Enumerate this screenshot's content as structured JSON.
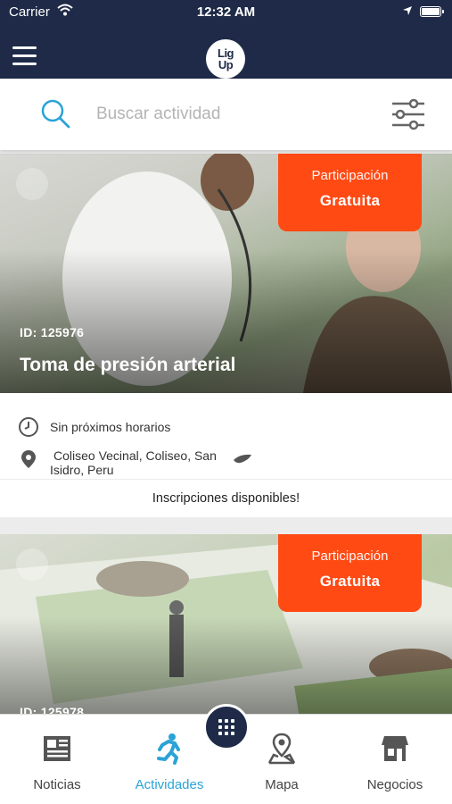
{
  "status_bar": {
    "carrier": "Carrier",
    "time": "12:32 AM"
  },
  "header": {
    "logo_text_top": "Lig",
    "logo_text_bottom": "Up"
  },
  "search": {
    "placeholder": "Buscar actividad",
    "value": ""
  },
  "colors": {
    "navy": "#1e2a47",
    "badge": "#ff4a14",
    "accent": "#2ba3d6"
  },
  "activities": [
    {
      "badge_top": "Participación",
      "badge_bottom": "Gratuita",
      "id_label": "ID: 125976",
      "title": "Toma de presión arterial",
      "schedule": "Sin próximos horarios",
      "location_line1": "Coliseo Vecinal,  Coliseo, San",
      "location_line2": "Isidro, Peru",
      "signup": "Inscripciones disponibles!"
    },
    {
      "badge_top": "Participación",
      "badge_bottom": "Gratuita",
      "id_label": "ID: 125978"
    }
  ],
  "tabs": [
    {
      "label": "Noticias",
      "icon": "newspaper-icon"
    },
    {
      "label": "Actividades",
      "icon": "runner-icon"
    },
    {
      "label": "Mapa",
      "icon": "map-pin-icon"
    },
    {
      "label": "Negocios",
      "icon": "store-icon"
    }
  ]
}
